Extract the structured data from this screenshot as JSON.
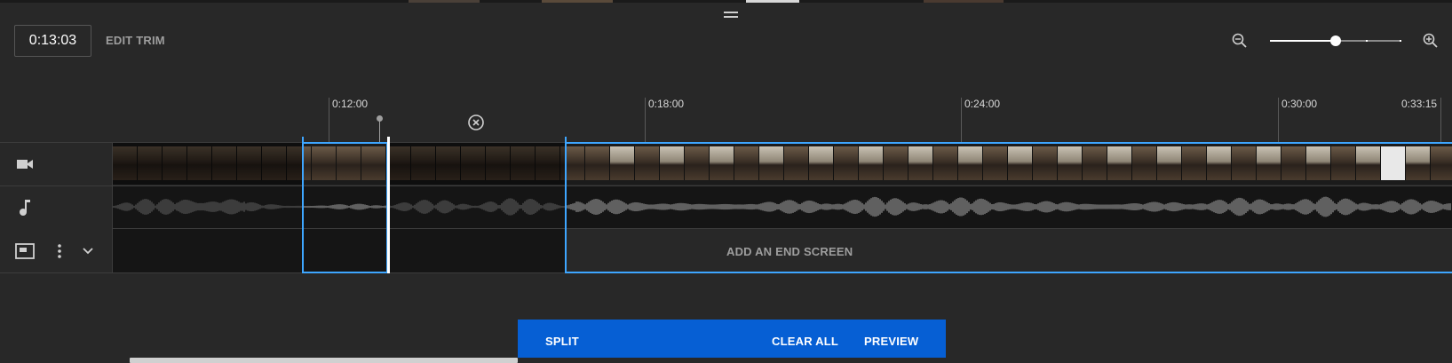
{
  "header": {
    "timecode": "0:13:03",
    "edit_trim_label": "EDIT TRIM"
  },
  "zoom": {
    "level": 0.5
  },
  "ruler": {
    "ticks": [
      {
        "label": "0:12:00"
      },
      {
        "label": "0:18:00"
      },
      {
        "label": "0:24:00"
      },
      {
        "label": "0:30:00"
      },
      {
        "label": "0:33:15"
      }
    ]
  },
  "tracks": {
    "video": {
      "icon": "video-camera-icon"
    },
    "audio": {
      "icon": "music-note-icon"
    },
    "end_screen": {
      "icon": "end-screen-icon",
      "label": "ADD AN END SCREEN"
    }
  },
  "actions": {
    "split": "SPLIT",
    "clear_all": "CLEAR ALL",
    "preview": "PREVIEW"
  },
  "colors": {
    "background": "#282828",
    "selection": "#3ea6ff",
    "action_bar": "#065fd4",
    "muted_text": "#9e9e9e"
  }
}
